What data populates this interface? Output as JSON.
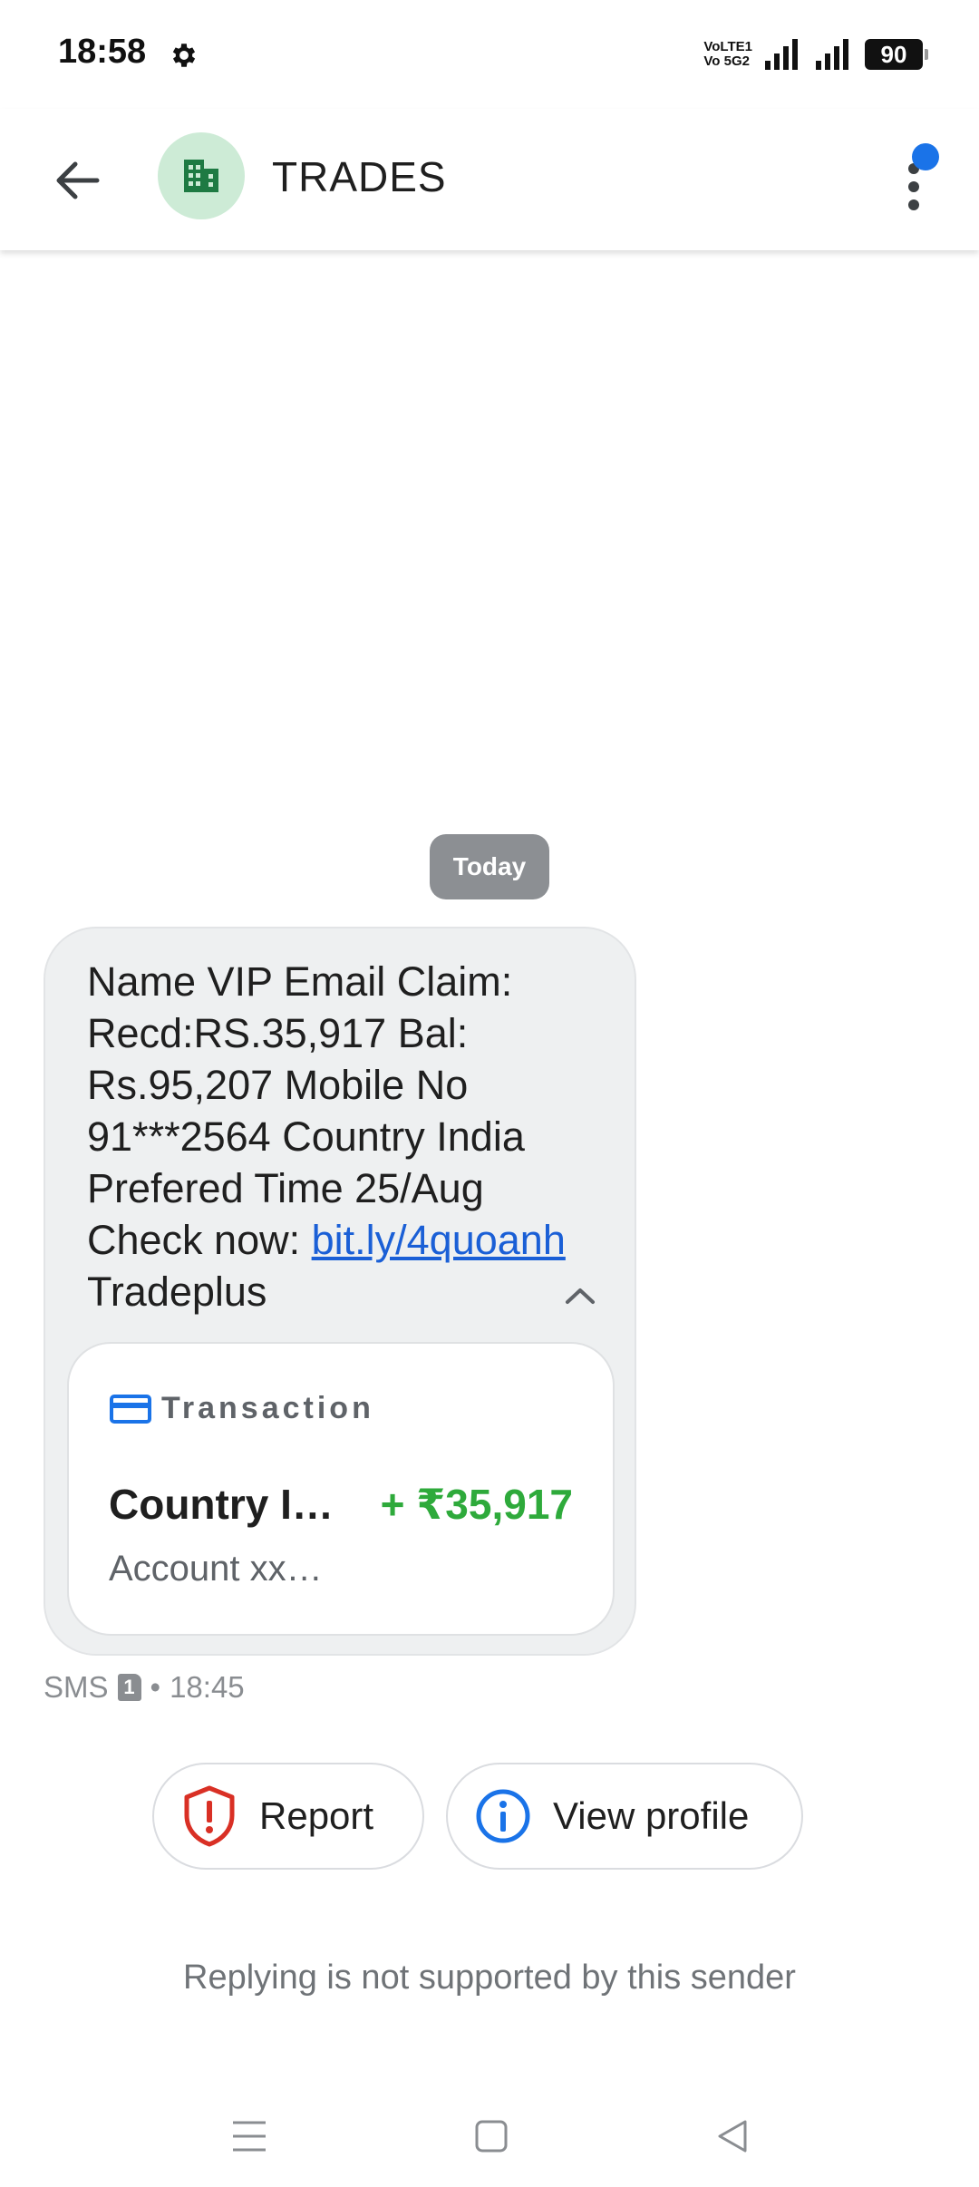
{
  "status_bar": {
    "time": "18:58",
    "network_label_top": "VoLTE1",
    "network_label_bottom": "Vo 5G2",
    "battery": "90"
  },
  "header": {
    "title": "TRADES",
    "avatar_icon": "building-icon",
    "accent_color": "#1a73e8"
  },
  "conversation": {
    "date_chip": "Today",
    "message": {
      "text_before_link": "Name VIP Email Claim: Recd:RS.35,917 Bal: Rs.95,207 Mobile No 91***2564 Country India Prefered Time 25/Aug Check now: ",
      "link_text": "bit.ly/4quoanh",
      "text_after_link": " Tradeplus"
    },
    "transaction": {
      "label": "Transaction",
      "name": "Country I…",
      "amount": "+ ₹35,917",
      "account": "Account xx…",
      "amount_color": "#2eaa3b"
    },
    "meta": {
      "type": "SMS",
      "sim": "1",
      "separator": "•",
      "time": "18:45"
    }
  },
  "actions": {
    "report_label": "Report",
    "view_profile_label": "View profile"
  },
  "reply_note": "Replying is not supported by this sender"
}
